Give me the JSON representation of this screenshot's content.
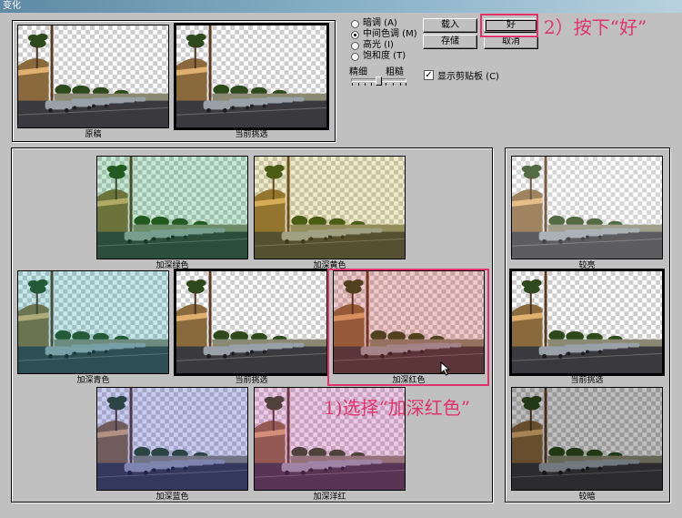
{
  "window": {
    "title": "变化"
  },
  "thumbs": {
    "original": "原稿",
    "current_pick_top": "当前挑选",
    "more_green": "加深绿色",
    "more_yellow": "加深黄色",
    "more_cyan": "加深青色",
    "current_pick_center": "当前挑选",
    "more_red": "加深红色",
    "more_blue": "加深蓝色",
    "more_magenta": "加深洋红",
    "lighter": "较亮",
    "current_pick_right": "当前挑选",
    "darker": "较暗"
  },
  "tones": {
    "options": [
      "暗调 (A)",
      "中间色调 (M)",
      "高光 (I)",
      "饱和度 (T)"
    ],
    "selected_index": 1
  },
  "slider": {
    "fine_label": "精细",
    "coarse_label": "粗糙"
  },
  "show_clipping": {
    "label": "显示剪贴板 (C)",
    "checked": true,
    "checkmark": "✓"
  },
  "buttons": {
    "load": "载入",
    "ok": "好",
    "save": "存储",
    "cancel": "取消"
  },
  "annotations": {
    "step2": "2）按下“好”",
    "step1": "1)选择“加深红色”"
  },
  "colors": {
    "annotation": "#e0336c"
  }
}
